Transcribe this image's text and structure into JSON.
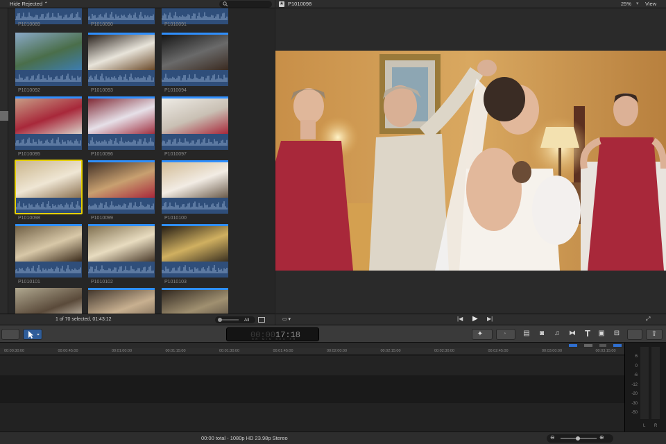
{
  "browser": {
    "filter_label": "Hide Rejected",
    "filter_arrow": "⌃",
    "top_row": [
      "P1010089",
      "P1010090",
      "P1010091"
    ],
    "clips": [
      {
        "name": "P1010092",
        "thumb": "pool",
        "bar": false
      },
      {
        "name": "P1010093",
        "thumb": "flowers",
        "bar": true
      },
      {
        "name": "P1010094",
        "thumb": "chair",
        "bar": true
      },
      {
        "name": "P1010095",
        "thumb": "bridesmaids",
        "bar": true
      },
      {
        "name": "P1010096",
        "thumb": "dress",
        "bar": true
      },
      {
        "name": "P1010097",
        "thumb": "window",
        "bar": true
      },
      {
        "name": "P1010098",
        "thumb": "bride",
        "bar": false,
        "selected": true
      },
      {
        "name": "P1010099",
        "thumb": "room",
        "bar": true
      },
      {
        "name": "P1010100",
        "thumb": "getting-ready",
        "bar": true
      },
      {
        "name": "P1010101",
        "thumb": "church",
        "bar": true
      },
      {
        "name": "P1010102",
        "thumb": "altar",
        "bar": true
      },
      {
        "name": "P1010103",
        "thumb": "ceiling",
        "bar": true
      },
      {
        "name": "",
        "thumb": "church2",
        "bar": false
      },
      {
        "name": "",
        "thumb": "altar2",
        "bar": true
      },
      {
        "name": "",
        "thumb": "church3",
        "bar": true
      }
    ],
    "selection_status": "1 of 70 selected, 01:43:12",
    "all_label": "All"
  },
  "viewer": {
    "title": "P1010098",
    "zoom": "25%",
    "zoom_arrow": "▾",
    "view_label": "View"
  },
  "toolbar": {
    "timecode_dim": "00:00",
    "timecode": "17:18",
    "timecode_units": "HR MIN SEC FR"
  },
  "timeline": {
    "ticks": [
      "00:00:30:00",
      "00:00:45:00",
      "00:01:00:00",
      "00:01:15:00",
      "00:01:30:00",
      "00:01:45:00",
      "00:02:00:00",
      "00:02:15:00",
      "00:02:30:00",
      "00:02:45:00",
      "00:03:00:00",
      "00:03:15:00"
    ]
  },
  "meters": {
    "scale": [
      "6",
      "0",
      "-6",
      "-12",
      "-20",
      "-30",
      "-50"
    ],
    "left": "L",
    "right": "R"
  },
  "status": {
    "text": "00:00 total - 1080p HD 23.98p Stereo"
  },
  "colors": {
    "selection": "#e6d000",
    "audio_waveform": "#2f4e7a",
    "marker_bar": "#2f8fff"
  }
}
